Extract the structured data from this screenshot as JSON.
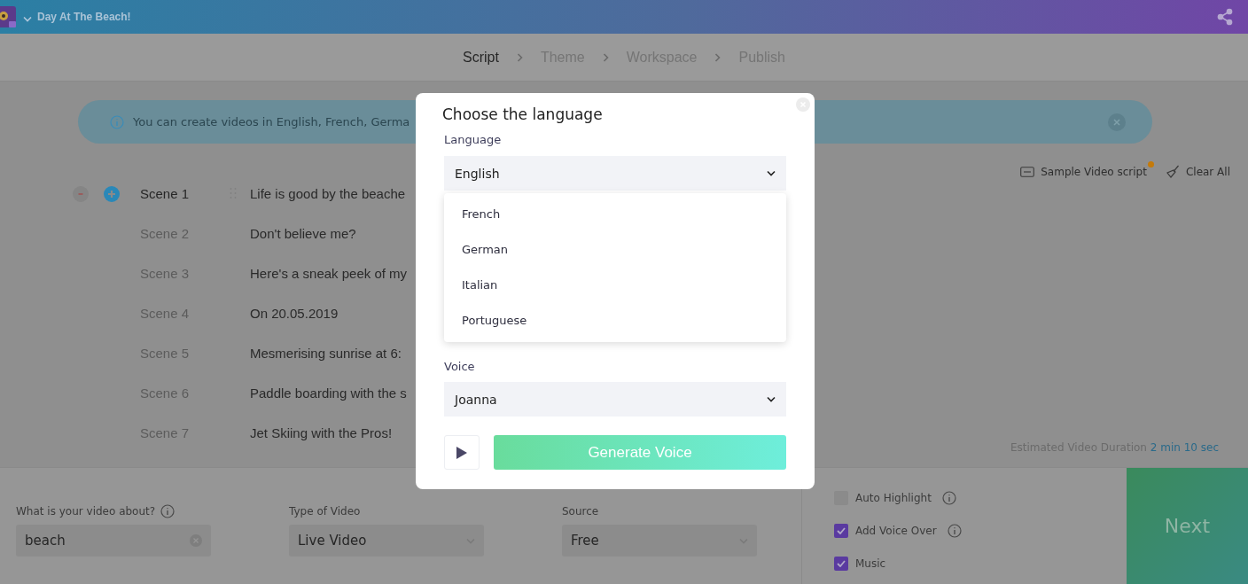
{
  "header": {
    "title": "Day At The Beach!"
  },
  "steps": [
    {
      "label": "Script",
      "selected": true
    },
    {
      "label": "Theme",
      "selected": false
    },
    {
      "label": "Workspace",
      "selected": false
    },
    {
      "label": "Publish",
      "selected": false
    }
  ],
  "banner": {
    "text": "You can create videos in English, French, Germa"
  },
  "toolbar": [
    {
      "kind": "sample",
      "label": "Sample Video script",
      "notified": true
    },
    {
      "kind": "clear",
      "label": "Clear All",
      "notified": false
    }
  ],
  "scenes": [
    {
      "label": "Scene 1",
      "text": "Life is good by the beache",
      "selected": true
    },
    {
      "label": "Scene 2",
      "text": "Don't believe me?",
      "selected": false
    },
    {
      "label": "Scene 3",
      "text": "Here's a sneak peek of my",
      "selected": false
    },
    {
      "label": "Scene 4",
      "text": "On 20.05.2019",
      "selected": false
    },
    {
      "label": "Scene 5",
      "text": "Mesmerising sunrise at 6:",
      "selected": false
    },
    {
      "label": "Scene 6",
      "text": "Paddle boarding with the s",
      "selected": false
    },
    {
      "label": "Scene 7",
      "text": "Jet Skiing with the Pros!",
      "selected": false
    }
  ],
  "duration": {
    "label": "Estimated Video Duration",
    "value": "2 min 10 sec"
  },
  "fields": [
    {
      "kind": "input",
      "label": "What is your video about?",
      "value": "beach",
      "info": true
    },
    {
      "kind": "select",
      "label": "Type of Video",
      "value": "Live Video"
    },
    {
      "kind": "select",
      "label": "Source",
      "value": "Free"
    }
  ],
  "options": [
    {
      "label": "Auto Highlight",
      "checked": false,
      "info": true
    },
    {
      "label": "Add Voice Over",
      "checked": true,
      "info": true
    },
    {
      "label": "Music",
      "checked": true
    }
  ],
  "next_button": "Next",
  "modal": {
    "title": "Choose the language",
    "language_label": "Language",
    "language_value": "English",
    "language_options": [
      "French",
      "German",
      "Italian",
      "Portuguese"
    ],
    "voice_label": "Voice",
    "voice_value": "Joanna",
    "generate_button": "Generate Voice"
  }
}
